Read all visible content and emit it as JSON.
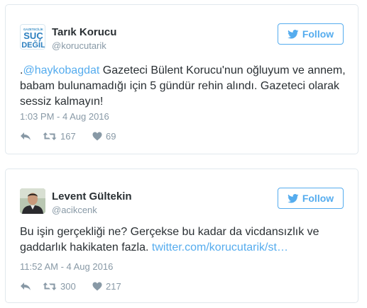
{
  "colors": {
    "accent": "#55acee",
    "text": "#292f33",
    "muted": "#8899a6",
    "border": "#e1e8ed"
  },
  "tweets": [
    {
      "name": "Tarık Korucu",
      "handle": "@korucutarik",
      "follow_label": "Follow",
      "avatar": {
        "line1": "GAZETECİLİK",
        "line2": "SUÇ",
        "line3": "DEĞİL"
      },
      "text_prefix": ".",
      "mention": "@haykobagdat",
      "text_body": " Gazeteci Bülent Korucu'nun oğluyum ve annem, babam bulunamadığı için 5 gündür rehin alındı. Gazeteci olarak sessiz kalmayın!",
      "timestamp": "1:03 PM - 4 Aug 2016",
      "retweets": "167",
      "likes": "69"
    },
    {
      "name": "Levent Gültekin",
      "handle": "@acikcenk",
      "follow_label": "Follow",
      "text_body": "Bu işin gerçekliği ne? Gerçekse bu kadar da vicdansızlık ve gaddarlık hakikaten fazla. ",
      "link": "twitter.com/korucutarik/st…",
      "timestamp": "11:52 AM - 4 Aug 2016",
      "retweets": "300",
      "likes": "217"
    }
  ]
}
